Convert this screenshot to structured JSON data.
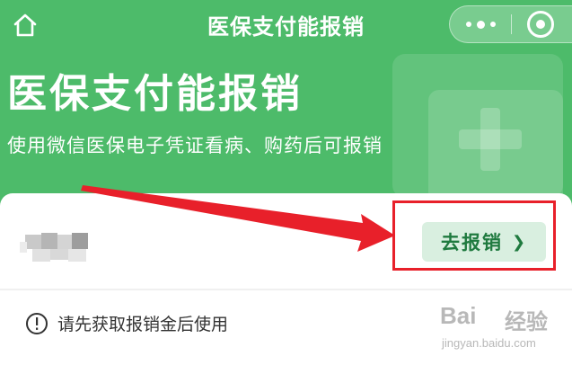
{
  "colors": {
    "header_green": "#4dbb6a",
    "button_bg": "#d9efe0",
    "button_text": "#1f7a3f",
    "annotation_red": "#e8202a"
  },
  "nav": {
    "home_icon": "home-icon",
    "title": "医保支付能报销",
    "more_icon": "more-dots-icon",
    "close_icon": "target-circle-icon"
  },
  "header": {
    "title": "医保支付能报销",
    "subtitle": "使用微信医保电子凭证看病、购药后可报销"
  },
  "card": {
    "avatar": "blurred-avatar",
    "claim_button_label": "去报销",
    "claim_button_icon": "chevron-right-icon",
    "notice_icon": "info-circle-icon",
    "notice_text": "请先获取报销金后使用"
  },
  "watermark": {
    "brand": "Bai",
    "brand2": "经验",
    "url": "jingyan.baidu.com"
  }
}
